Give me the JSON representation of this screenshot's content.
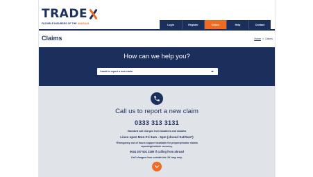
{
  "header": {
    "logo_text": "TRADEX",
    "logo_tagline_prefix": "FLEXIBLE INSURERS OF THE",
    "logo_tagline_highlight": "UNUSUAL",
    "nav": [
      {
        "label": "Login",
        "active": false
      },
      {
        "label": "Register",
        "active": false
      },
      {
        "label": "Claims",
        "active": true
      },
      {
        "label": "Help",
        "active": false
      },
      {
        "label": "Contact",
        "active": false
      }
    ]
  },
  "page": {
    "title": "Claims",
    "breadcrumb": {
      "home": "Home",
      "separator": ">",
      "current": "Claims"
    }
  },
  "hero": {
    "question": "How can we help you?",
    "select_value": "I want to report a new claim"
  },
  "call": {
    "title": "Call us to report a new claim",
    "number": "0333 313 3131",
    "note_standard": "Standard call charges from landlines and mobiles",
    "hours": "Lines open Mon-Fri 9am - 5pm (closed Sat/Sun*)",
    "emergency_line1": "*Emergency out of hours support available for property/motor claims",
    "emergency_line2": "reporting/vehicle recovery.",
    "abroad": "0044 207 531 3180 if calling from abroad",
    "abroad_note": "Call charges from outside the UK may vary."
  },
  "colors": {
    "navy": "#1b2f5c",
    "orange": "#f26a21",
    "light_grey": "#e0e3e8"
  },
  "icons": [
    "phone-icon",
    "chevron-down-icon",
    "caret-down-icon"
  ]
}
